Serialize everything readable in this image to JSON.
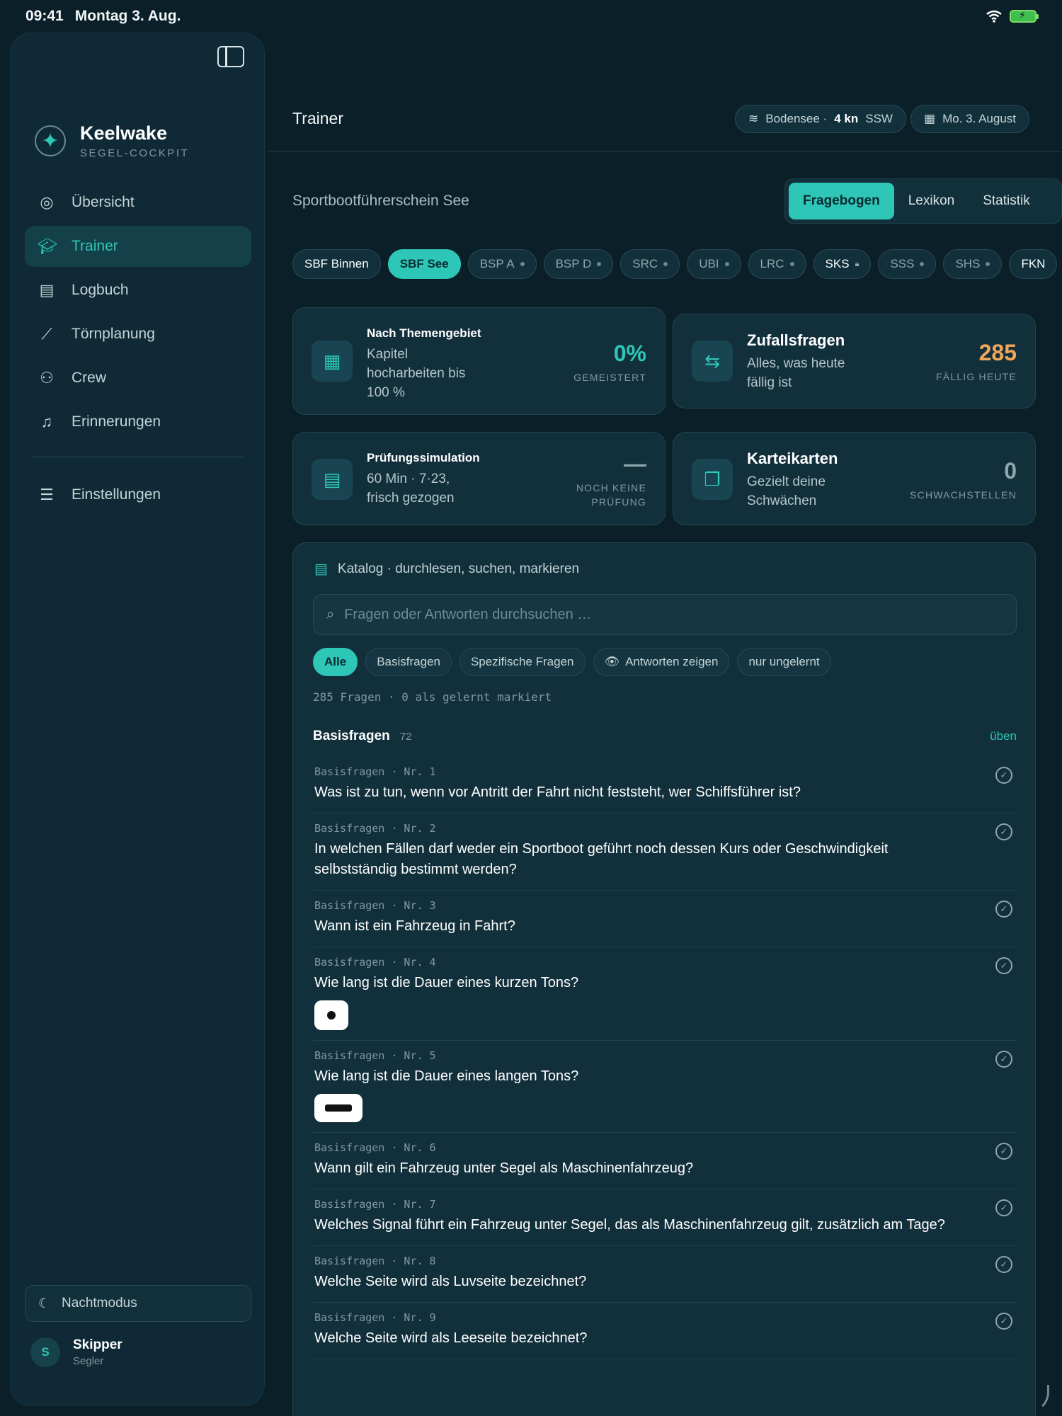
{
  "status_bar": {
    "time": "09:41",
    "date": "Montag 3. Aug.",
    "battery_icon": "battery-charging-icon",
    "wifi_icon": "wifi-icon"
  },
  "brand": {
    "title": "Keelwake",
    "subtitle": "SEGEL-COCKPIT",
    "logo_icon": "compass-star-icon"
  },
  "nav": {
    "items": [
      {
        "label": "Übersicht",
        "icon": "compass-icon",
        "active": false
      },
      {
        "label": "Trainer",
        "icon": "graduation-cap-icon",
        "active": true
      },
      {
        "label": "Logbuch",
        "icon": "book-icon",
        "active": false
      },
      {
        "label": "Törnplanung",
        "icon": "route-icon",
        "active": false
      },
      {
        "label": "Crew",
        "icon": "users-icon",
        "active": false
      },
      {
        "label": "Erinnerungen",
        "icon": "bell-icon",
        "active": false
      }
    ],
    "settings": {
      "label": "Einstellungen",
      "icon": "sliders-icon"
    },
    "night_mode": "Nachtmodus"
  },
  "user": {
    "initial": "S",
    "name": "Skipper",
    "role": "Segler"
  },
  "header": {
    "title": "Trainer",
    "weather_prefix": "Bodensee ·",
    "weather_wind": "4 kn",
    "weather_dir": "SSW",
    "date": "Mo. 3. August"
  },
  "license": "Sportbootführerschein See",
  "tabs": [
    {
      "label": "Fragebogen",
      "active": true
    },
    {
      "label": "Lexikon",
      "active": false
    },
    {
      "label": "Statistik",
      "active": false
    }
  ],
  "chips": [
    {
      "label": "SBF Binnen",
      "state": "bright"
    },
    {
      "label": "SBF See",
      "state": "active"
    },
    {
      "label": "BSP A",
      "state": "dot"
    },
    {
      "label": "BSP D",
      "state": "dot"
    },
    {
      "label": "SRC",
      "state": "dot"
    },
    {
      "label": "UBI",
      "state": "dot"
    },
    {
      "label": "LRC",
      "state": "dot"
    },
    {
      "label": "SKS",
      "state": "lock"
    },
    {
      "label": "SSS",
      "state": "dot"
    },
    {
      "label": "SHS",
      "state": "dot"
    },
    {
      "label": "FKN",
      "state": "bright"
    }
  ],
  "cards": {
    "topic": {
      "title": "Nach Themengebiet",
      "desc": "Kapitel hocharbeiten bis 100 %",
      "value": "0%",
      "label": "GEMEISTERT",
      "value_color": "#2ec7b7"
    },
    "random": {
      "title": "Zufallsfragen",
      "desc": "Alles, was heute fällig ist",
      "value": "285",
      "label": "FÄLLIG HEUTE",
      "value_color": "#f2a65a"
    },
    "exam": {
      "title": "Prüfungssimulation",
      "desc": "60 Min · 7·23, frisch gezogen",
      "value": "—",
      "label_1": "NOCH KEINE",
      "label_2": "PRÜFUNG",
      "value_color": "#8ea6ad"
    },
    "flash": {
      "title": "Karteikarten",
      "desc": "Gezielt deine Schwächen",
      "value": "0",
      "label": "SCHWACHSTELLEN",
      "value_color": "#8ea6ad"
    }
  },
  "catalog": {
    "title": "Katalog · durchlesen, suchen, markieren",
    "search_placeholder": "Fragen oder Antworten durchsuchen …",
    "filters": [
      "Alle",
      "Basisfragen",
      "Spezifische Fragen",
      "Antworten zeigen",
      "nur ungelernt"
    ],
    "count": "285 Fragen · 0 als gelernt markiert",
    "section": {
      "title": "Basisfragen",
      "count": "72",
      "action": "üben"
    },
    "questions": [
      {
        "meta": "Basisfragen · Nr. 1",
        "text": "Was ist zu tun, wenn vor Antritt der Fahrt nicht feststeht, wer Schiffsführer ist?"
      },
      {
        "meta": "Basisfragen · Nr. 2",
        "text": "In welchen Fällen darf weder ein Sportboot geführt noch dessen Kurs oder Geschwindigkeit selbstständig bestimmt werden?"
      },
      {
        "meta": "Basisfragen · Nr. 3",
        "text": "Wann ist ein Fahrzeug in Fahrt?"
      },
      {
        "meta": "Basisfragen · Nr. 4",
        "text": "Wie lang ist die Dauer eines kurzen Tons?"
      },
      {
        "meta": "Basisfragen · Nr. 5",
        "text": "Wie lang ist die Dauer eines langen Tons?"
      },
      {
        "meta": "Basisfragen · Nr. 6",
        "text": "Wann gilt ein Fahrzeug unter Segel als Maschinenfahrzeug?"
      },
      {
        "meta": "Basisfragen · Nr. 7",
        "text": "Welches Signal führt ein Fahrzeug unter Segel, das als Maschinenfahrzeug gilt, zusätzlich am Tage?"
      },
      {
        "meta": "Basisfragen · Nr. 8",
        "text": "Welche Seite wird als Luvseite bezeichnet?"
      },
      {
        "meta": "Basisfragen · Nr. 9",
        "text": "Welche Seite wird als Leeseite bezeichnet?"
      }
    ]
  }
}
